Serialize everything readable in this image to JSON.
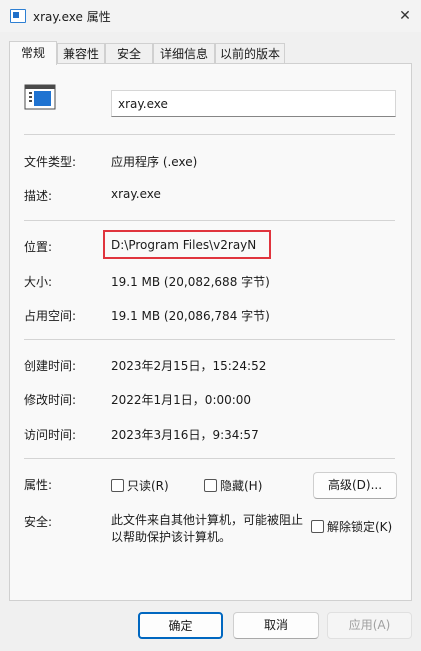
{
  "window": {
    "title": "xray.exe 属性",
    "close_glyph": "✕"
  },
  "tabs": [
    {
      "label": "常规",
      "active": true
    },
    {
      "label": "兼容性",
      "active": false
    },
    {
      "label": "安全",
      "active": false
    },
    {
      "label": "详细信息",
      "active": false
    },
    {
      "label": "以前的版本",
      "active": false
    }
  ],
  "general": {
    "file_name": "xray.exe",
    "file_type_label": "文件类型:",
    "file_type_value": "应用程序 (.exe)",
    "description_label": "描述:",
    "description_value": "xray.exe",
    "location_label": "位置:",
    "location_value": "D:\\Program Files\\v2rayN",
    "size_label": "大小:",
    "size_value": "19.1 MB (20,082,688 字节)",
    "size_on_disk_label": "占用空间:",
    "size_on_disk_value": "19.1 MB (20,086,784 字节)",
    "created_label": "创建时间:",
    "created_value": "2023年2月15日，15:24:52",
    "modified_label": "修改时间:",
    "modified_value": "2022年1月1日，0:00:00",
    "accessed_label": "访问时间:",
    "accessed_value": "2023年3月16日，9:34:57",
    "attributes_label": "属性:",
    "readonly_label": "只读(R)",
    "hidden_label": "隐藏(H)",
    "advanced_label": "高级(D)...",
    "security_label": "安全:",
    "security_text": "此文件来自其他计算机，可能被阻止以帮助保护该计算机。",
    "unblock_label": "解除锁定(K)"
  },
  "footer": {
    "ok_label": "确定",
    "cancel_label": "取消",
    "apply_label": "应用(A)"
  },
  "colors": {
    "highlight_border": "#e0343d",
    "accent": "#0067c0"
  }
}
